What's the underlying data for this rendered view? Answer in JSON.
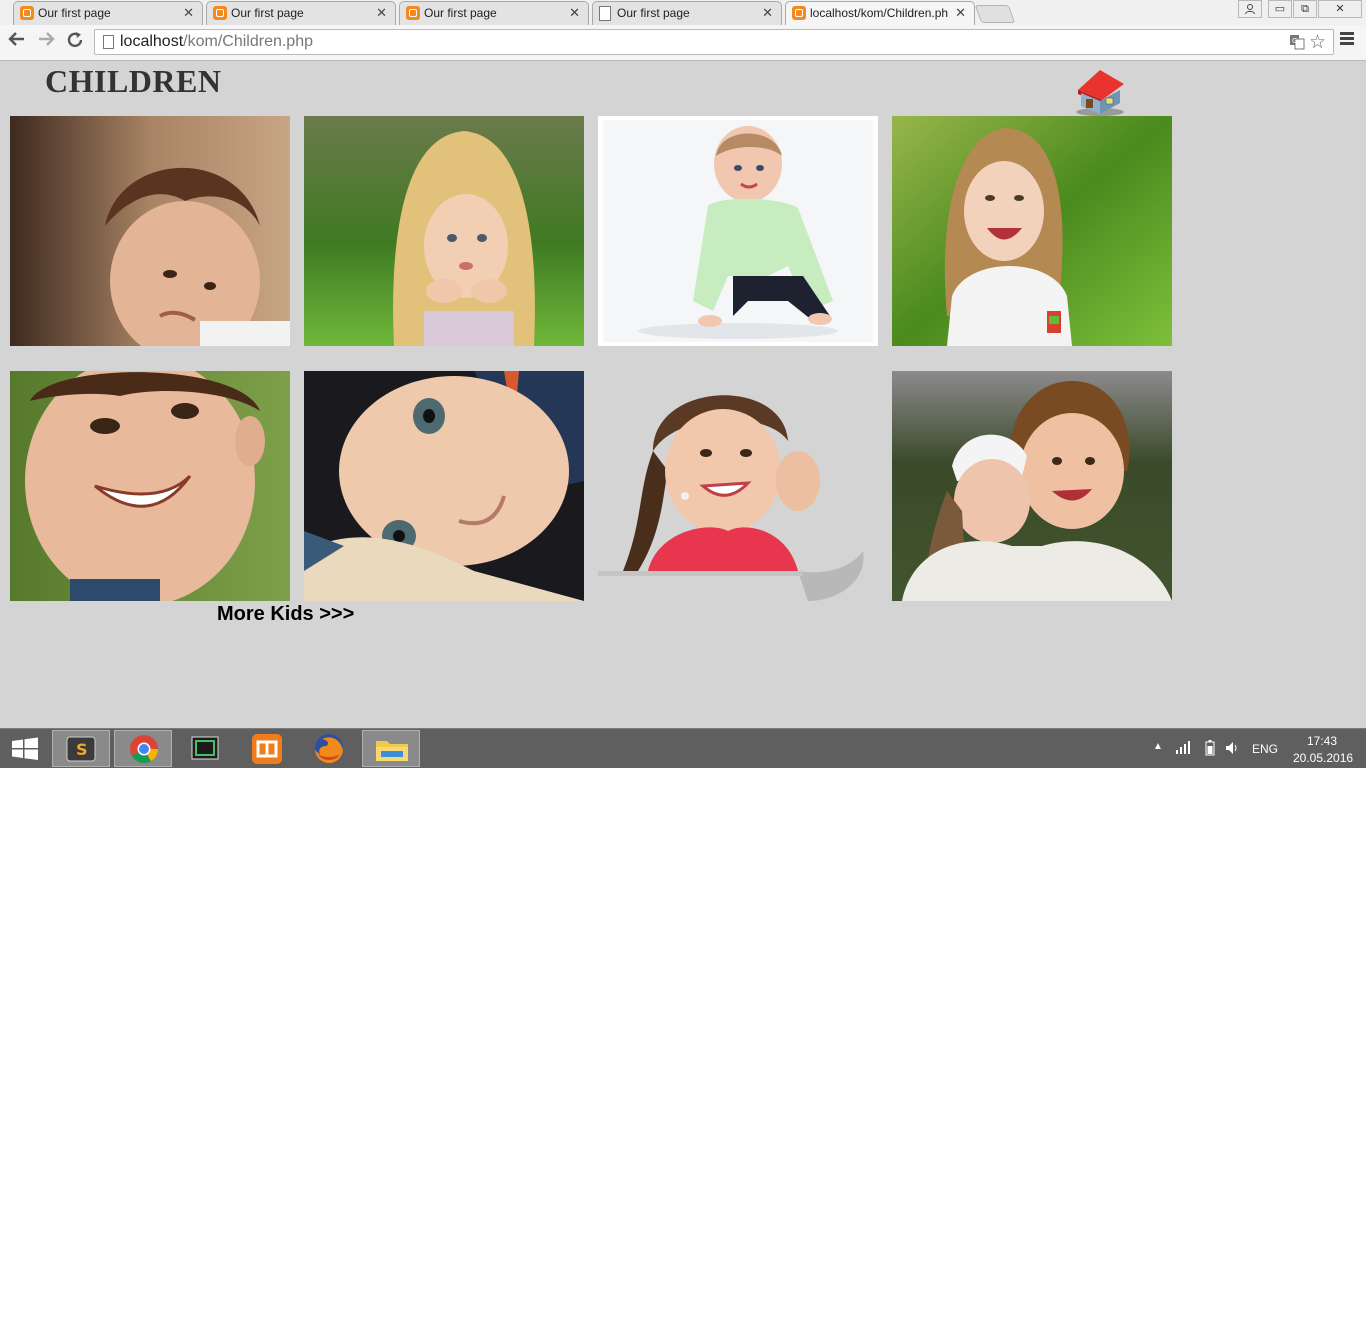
{
  "browser": {
    "tabs": [
      {
        "title": "Our first page",
        "icon": "xampp-icon",
        "active": false
      },
      {
        "title": "Our first page",
        "icon": "xampp-icon",
        "active": false
      },
      {
        "title": "Our first page",
        "icon": "xampp-icon",
        "active": false
      },
      {
        "title": "Our first page",
        "icon": "page-icon",
        "active": false
      },
      {
        "title": "localhost/kom/Children.php",
        "icon": "xampp-icon",
        "active": true
      }
    ],
    "address": {
      "host": "localhost",
      "path": "/kom/Children.php"
    }
  },
  "page": {
    "title": "CHILDREN",
    "more_link": "More Kids >>>",
    "photos": [
      {
        "name": "photo-sad-toddler"
      },
      {
        "name": "photo-blonde-girl-in-grass"
      },
      {
        "name": "photo-crawling-baby"
      },
      {
        "name": "photo-laughing-girl"
      },
      {
        "name": "photo-smiling-boy"
      },
      {
        "name": "photo-child-lying-down"
      },
      {
        "name": "photo-girl-with-braids"
      },
      {
        "name": "photo-boy-and-girl"
      }
    ]
  },
  "taskbar": {
    "apps": [
      "start-icon",
      "sublime-text-icon",
      "chrome-icon",
      "terminal-icon",
      "xampp-icon",
      "firefox-icon",
      "file-explorer-icon"
    ],
    "language": "ENG",
    "time": "17:43",
    "date": "20.05.2016"
  },
  "colors": {
    "page_bg": "#d4d4d4",
    "taskbar_bg": "#5f5f5f"
  }
}
